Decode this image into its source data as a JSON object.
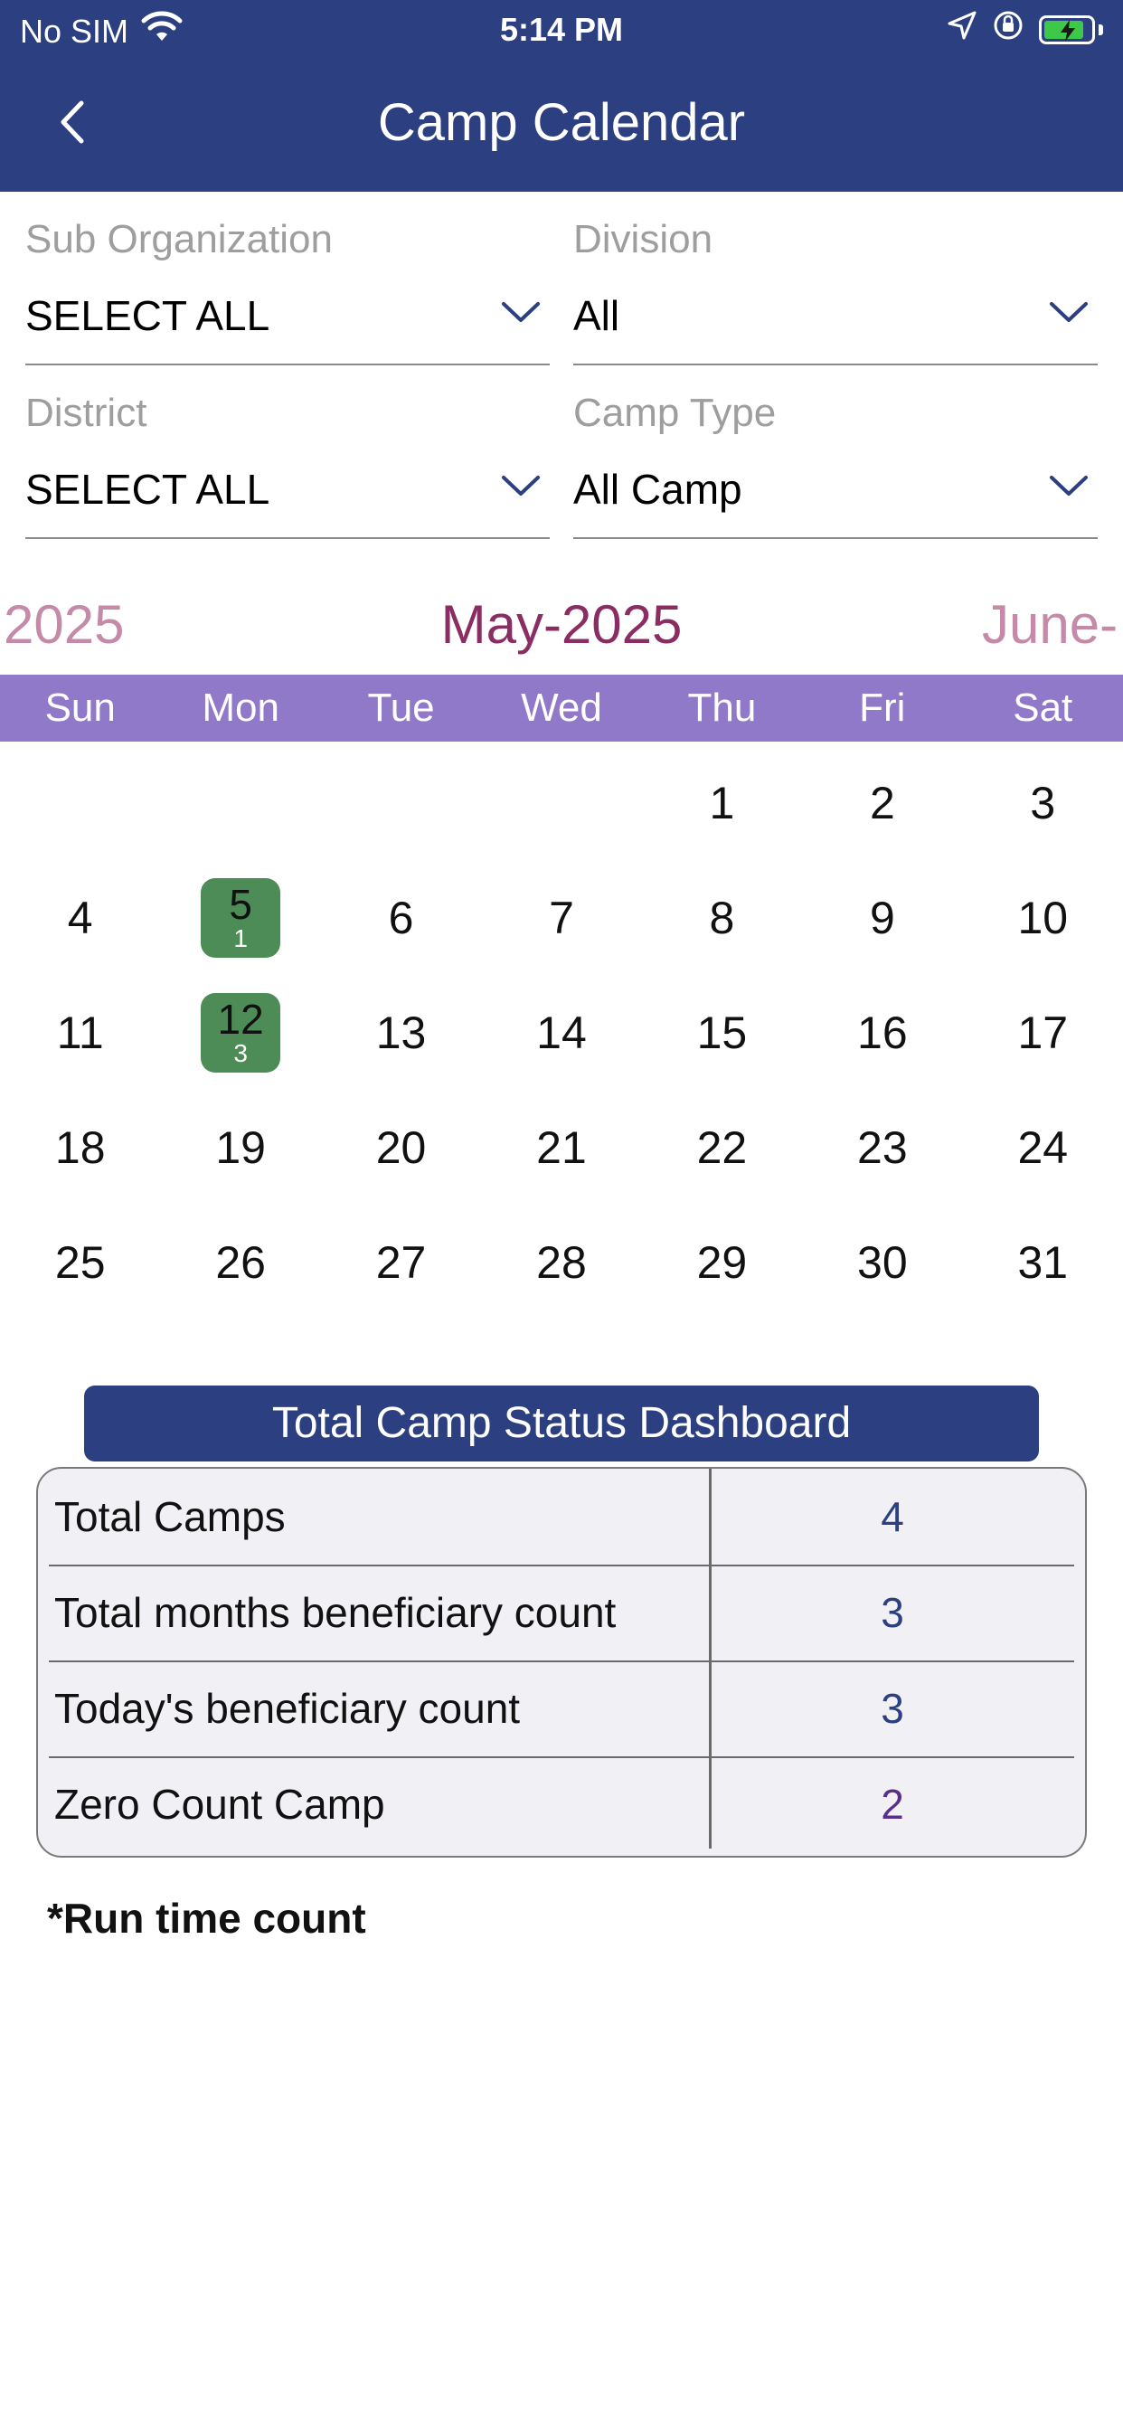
{
  "status_bar": {
    "carrier": "No SIM",
    "time": "5:14 PM",
    "battery_level": 0.85,
    "battery_color": "#3ec84a"
  },
  "nav": {
    "title": "Camp Calendar",
    "back_icon": "chevron-left-icon"
  },
  "filters": [
    {
      "label": "Sub Organization",
      "value": "SELECT ALL"
    },
    {
      "label": "Division",
      "value": "All"
    },
    {
      "label": "District",
      "value": "SELECT ALL"
    },
    {
      "label": "Camp Type",
      "value": "All Camp"
    }
  ],
  "calendar": {
    "prev_month": "2025",
    "current_month": "May-2025",
    "next_month": "June-",
    "weekdays": [
      "Sun",
      "Mon",
      "Tue",
      "Wed",
      "Thu",
      "Fri",
      "Sat"
    ],
    "days": [
      "",
      "",
      "",
      "",
      "1",
      "2",
      "3",
      "4",
      "5",
      "6",
      "7",
      "8",
      "9",
      "10",
      "11",
      "12",
      "13",
      "14",
      "15",
      "16",
      "17",
      "18",
      "19",
      "20",
      "21",
      "22",
      "23",
      "24",
      "25",
      "26",
      "27",
      "28",
      "29",
      "30",
      "31"
    ],
    "events": [
      {
        "day": "5",
        "count": "1"
      },
      {
        "day": "12",
        "count": "3"
      }
    ],
    "event_color": "#4d8c57"
  },
  "dashboard": {
    "title": "Total Camp Status Dashboard",
    "rows": [
      {
        "label": "Total Camps",
        "value": "4"
      },
      {
        "label": "Total months beneficiary count",
        "value": "3"
      },
      {
        "label": "Today's beneficiary count",
        "value": "3"
      },
      {
        "label": "Zero Count Camp",
        "value": "2"
      }
    ]
  },
  "footnote": "*Run time count",
  "colors": {
    "header": "#2c3f80",
    "weekday_bar": "#9179c9",
    "month_current": "#8a2d62",
    "month_adjacent": "#c48aa8"
  }
}
